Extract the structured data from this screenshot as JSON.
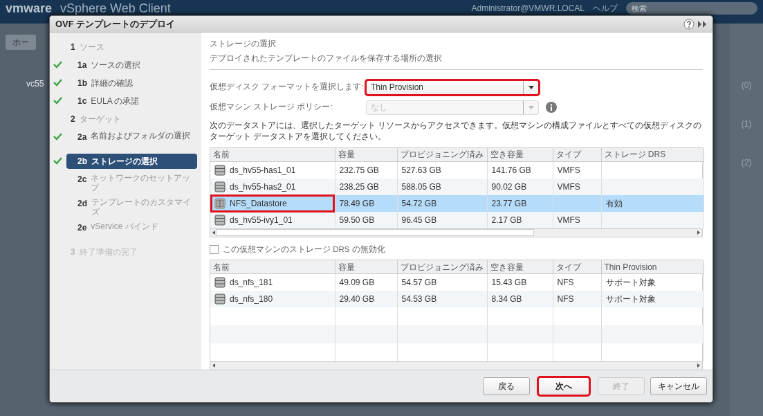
{
  "app_header": {
    "logo": "vmware",
    "product": "vSphere Web Client",
    "user": "Administrator@VMWR.LOCAL",
    "help": "ヘルプ",
    "search_placeholder": "検索"
  },
  "backdrop": {
    "home_tab": "ホー",
    "tree_item": "vc55",
    "side_counts": [
      "(0)",
      "(1)",
      "(2)"
    ]
  },
  "dialog": {
    "title": "OVF テンプレートのデプロイ",
    "steps": [
      {
        "kind": "group",
        "number": "1",
        "label": "ソース",
        "done": false,
        "selected": false,
        "disabled": false
      },
      {
        "kind": "step",
        "number": "1a",
        "label": "ソースの選択",
        "done": true,
        "selected": false,
        "disabled": false
      },
      {
        "kind": "step",
        "number": "1b",
        "label": "詳細の確認",
        "done": true,
        "selected": false,
        "disabled": false
      },
      {
        "kind": "step",
        "number": "1c",
        "label": "EULA の承諾",
        "done": true,
        "selected": false,
        "disabled": false
      },
      {
        "kind": "group",
        "number": "2",
        "label": "ターゲット",
        "done": false,
        "selected": false,
        "disabled": false
      },
      {
        "kind": "step",
        "number": "2a",
        "label": "名前およびフォルダの選択",
        "done": true,
        "selected": false,
        "disabled": false
      },
      {
        "kind": "step",
        "number": "2b",
        "label": "ストレージの選択",
        "done": true,
        "selected": true,
        "disabled": false
      },
      {
        "kind": "step",
        "number": "2c",
        "label": "ネットワークのセットアップ",
        "done": false,
        "selected": false,
        "disabled": false
      },
      {
        "kind": "step",
        "number": "2d",
        "label": "テンプレートのカスタマイズ",
        "done": false,
        "selected": false,
        "disabled": false
      },
      {
        "kind": "step",
        "number": "2e",
        "label": "vService バインド",
        "done": false,
        "selected": false,
        "disabled": false
      },
      {
        "kind": "group",
        "number": "3",
        "label": "終了準備の完了",
        "done": false,
        "selected": false,
        "disabled": true
      }
    ],
    "heading": "ストレージの選択",
    "subheading": "デプロイされたテンプレートのファイルを保存する場所の選択",
    "fields": [
      {
        "label": "仮想ディスク フォーマットを選択します:",
        "value": "Thin Provision",
        "disabled": false,
        "highlighted": true,
        "info": false
      },
      {
        "label": "仮想マシン ストレージ ポリシー:",
        "value": "なし",
        "disabled": true,
        "highlighted": false,
        "info": true
      }
    ],
    "description": "次のデータストアには、選択したターゲット リソースからアクセスできます。仮想マシンの構成ファイルとすべての仮想ディスクのターゲット データストアを選択してください。",
    "datastore_table": {
      "columns": [
        "名前",
        "容量",
        "プロビジョニング済み",
        "空き容量",
        "タイプ",
        "ストレージ DRS"
      ],
      "rows": [
        {
          "kind": "datastore",
          "selected": false,
          "highlighted": false,
          "cells": [
            "ds_hv55-has1_01",
            "232.75 GB",
            "527.63 GB",
            "141.76 GB",
            "VMFS",
            ""
          ]
        },
        {
          "kind": "datastore",
          "selected": false,
          "highlighted": false,
          "cells": [
            "ds_hv55-has2_01",
            "238.25 GB",
            "588.05 GB",
            "90.02 GB",
            "VMFS",
            ""
          ]
        },
        {
          "kind": "cluster",
          "selected": true,
          "highlighted": true,
          "cells": [
            "NFS_Datastore",
            "78.49 GB",
            "54.72 GB",
            "23.77 GB",
            "",
            "有効"
          ]
        },
        {
          "kind": "datastore",
          "selected": false,
          "highlighted": false,
          "cells": [
            "ds_hv55-ivy1_01",
            "59.50 GB",
            "96.45 GB",
            "2.17 GB",
            "VMFS",
            ""
          ]
        }
      ]
    },
    "drs_checkbox": {
      "label": "この仮想マシンのストレージ DRS の無効化",
      "checked": false
    },
    "cluster_table": {
      "columns": [
        "名前",
        "容量",
        "プロビジョニング済み",
        "空き容量",
        "タイプ",
        "Thin Provision"
      ],
      "rows": [
        {
          "kind": "datastore",
          "selected": false,
          "highlighted": false,
          "cells": [
            "ds_nfs_181",
            "49.09 GB",
            "54.57 GB",
            "15.43 GB",
            "NFS",
            "サポート対象"
          ]
        },
        {
          "kind": "datastore",
          "selected": false,
          "highlighted": false,
          "cells": [
            "ds_nfs_180",
            "29.40 GB",
            "54.53 GB",
            "8.34 GB",
            "NFS",
            "サポート対象"
          ]
        }
      ]
    },
    "buttons": [
      {
        "label": "戻る",
        "disabled": false,
        "highlighted": false
      },
      {
        "label": "次へ",
        "disabled": false,
        "highlighted": true
      },
      {
        "label": "終了",
        "disabled": true,
        "highlighted": false
      },
      {
        "label": "キャンセル",
        "disabled": false,
        "highlighted": false
      }
    ]
  }
}
